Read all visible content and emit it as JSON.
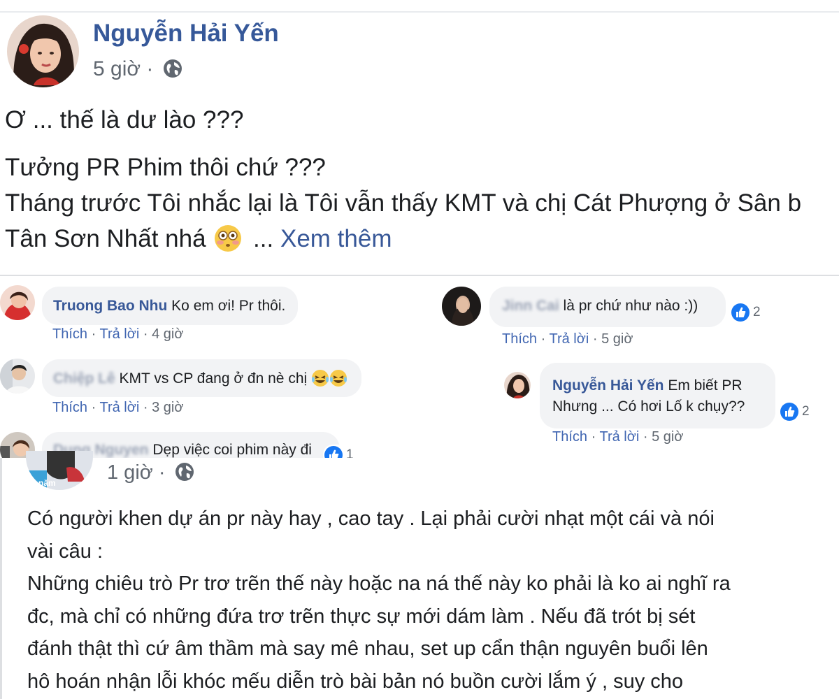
{
  "post": {
    "author": "Nguyễn Hải Yến",
    "time": "5 giờ",
    "separator": "·",
    "privacy_icon": "globe-icon",
    "lines": [
      "Ơ ... thế là dư lào ???",
      "Tưởng PR Phim thôi chứ ???",
      "Tháng trước Tôi nhắc lại là Tôi vẫn thấy KMT và chị Cát Phượng ở Sân b",
      "Tân Sơn Nhất nhá"
    ],
    "ellipsis": "...",
    "see_more": "Xem thêm"
  },
  "comments_left": [
    {
      "name": "Truong Bao Nhu",
      "text": "Ko em ơi! Pr thôi.",
      "like": "Thích",
      "reply": "Trả lời",
      "time": "4 giờ",
      "sep": "·"
    },
    {
      "name": "Chiệp Lê",
      "text": "KMT vs CP đang ở đn nè chị",
      "like": "Thích",
      "reply": "Trả lời",
      "time": "3 giờ",
      "sep": "·"
    },
    {
      "name": "Dung Nguyen",
      "text": "Dẹp việc coi phim này đi",
      "reactions": "1"
    }
  ],
  "comments_right": [
    {
      "name": "Jinn Cai",
      "text": "là pr chứ như nào :))",
      "reactions": "2",
      "like": "Thích",
      "reply": "Trả lời",
      "time": "5 giờ",
      "sep": "·"
    },
    {
      "name": "Nguyễn Hải Yến",
      "text_line1": "Em biết PR",
      "text_line2": "Nhưng ... Có hơi Lố k chụy??",
      "reactions": "2",
      "like": "Thích",
      "reply": "Trả lời",
      "time": "5 giờ",
      "sep": "·"
    }
  ],
  "post2": {
    "badge": "2 năm",
    "time": "1 giờ",
    "separator": "·",
    "privacy_icon": "globe-icon",
    "lines": [
      "Có người khen dự án pr này hay , cao tay . Lại phải cười nhạt một cái và nói",
      "vài câu :",
      "Những chiêu trò Pr trơ trẽn thế này hoặc na ná thế này ko phải là ko ai nghĩ ra",
      "đc, mà chỉ có những đứa trơ trẽn thực sự mới dám làm . Nếu đã trót bị sét",
      "đánh thật thì cứ âm thầm mà say mê nhau, set up cẩn thận nguyên buổi lên",
      "hô hoán nhận lỗi khóc mếu diễn trò bài bản nó buồn cười lắm ý , suy cho"
    ]
  },
  "colors": {
    "link": "#385898",
    "bubble": "#f2f3f5",
    "like_blue": "#1877f2",
    "meta": "#606770"
  }
}
